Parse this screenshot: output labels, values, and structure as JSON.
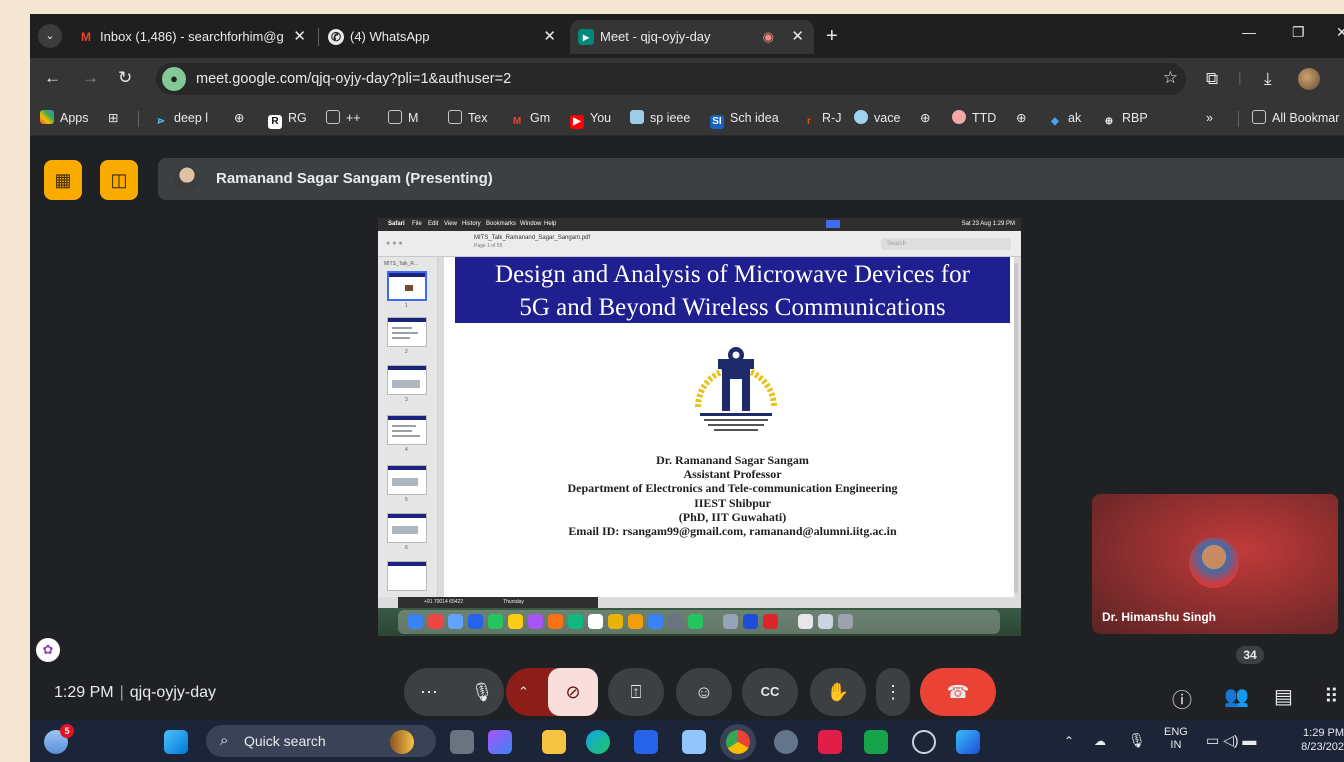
{
  "browser": {
    "tabs": [
      {
        "title": "Inbox (1,486) - searchforhim@g",
        "icon": "gmail-icon"
      },
      {
        "title": "(4) WhatsApp",
        "icon": "whatsapp-icon"
      },
      {
        "title": "Meet - qjq-oyjy-day",
        "icon": "meet-icon",
        "active": true
      }
    ],
    "url": "meet.google.com/qjq-oyjy-day?pli=1&authuser=2",
    "bookmarks": [
      "Apps",
      "deep l",
      "RG",
      "++",
      "M",
      "Tex",
      "Gm",
      "You",
      "sp ieee",
      "Sch idea",
      "R-J",
      "vace",
      "TTD",
      "ak",
      "RBP"
    ],
    "bookmarks_overflow": "»",
    "all_bookmarks": "All Bookmar"
  },
  "meet": {
    "presenter_label": "Ramanand Sagar Sangam (Presenting)",
    "time": "1:29 PM",
    "meeting_code": "qjq-oyjy-day",
    "participant_name": "Dr. Himanshu Singh",
    "participant_count": "34"
  },
  "shared_screen": {
    "mac_menu": [
      "Safari",
      "File",
      "Edit",
      "View",
      "History",
      "Bookmarks",
      "Window",
      "Help"
    ],
    "mac_clock": "Sat 23 Aug 1:29 PM",
    "pdf_filename": "MITS_Talk_Ramanand_Sagar_Sangam.pdf",
    "pdf_page": "Page 1 of 55",
    "sidebar_name": "MITS_Talk_R...",
    "thumb_numbers": [
      "1",
      "2",
      "3",
      "4",
      "5",
      "6"
    ],
    "search_placeholder": "Search",
    "slide_title_line1": "Design and Analysis of Microwave Devices for",
    "slide_title_line2": "5G and Beyond Wireless Communications",
    "author_lines": [
      "Dr. Ramanand Sagar Sangam",
      "Assistant Professor",
      "Department of Electronics and Tele-communication Engineering",
      "IIEST Shibpur",
      "(PhD, IIT Guwahati)",
      "Email ID: rsangam99@gmail.com, ramanand@alumni.iitg.ac.in"
    ],
    "caller_text": "+91 70014 65422",
    "caller_day": "Thursday"
  },
  "taskbar": {
    "search_placeholder": "Quick search",
    "weather_badge": "5",
    "lang_top": "ENG",
    "lang_bottom": "IN",
    "clock_time": "1:29 PM",
    "clock_date": "8/23/202"
  },
  "colors": {
    "meet_bg": "#202124",
    "accent_yellow": "#f9ab00",
    "end_call": "#ea4335",
    "slide_title_band": "#1f1f8f"
  }
}
